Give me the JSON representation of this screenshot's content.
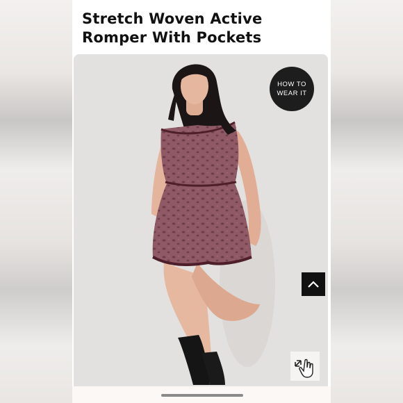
{
  "product": {
    "title_line1": "Stretch Woven Active",
    "title_line2": "Romper With Pockets"
  },
  "gallery": {
    "how_to_line1": "HOW TO",
    "how_to_line2": "WEAR IT",
    "scroll_top_icon": "chevron-up-icon",
    "zoom_icon": "hand-pointer-expand-icon",
    "romper_color": "#8f5a66",
    "trim_color": "#4e1f2a"
  }
}
